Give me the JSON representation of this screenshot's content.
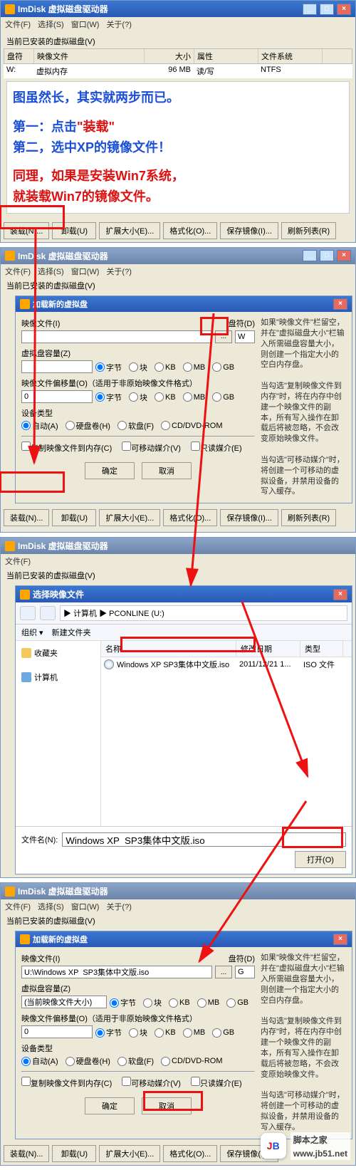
{
  "win1": {
    "title": "ImDisk 虚拟磁盘驱动器",
    "menu": [
      "文件(F)",
      "选择(S)",
      "窗口(W)",
      "关于(?)"
    ],
    "installed_label": "当前已安装的虚拟磁盘(V)",
    "cols": {
      "drive": "盘符",
      "image": "映像文件",
      "size": "大小",
      "attr": "属性",
      "fs": "文件系统"
    },
    "row": {
      "drive": "W:",
      "image": "虚拟内存",
      "size": "96 MB",
      "attr": "读/写",
      "fs": "NTFS"
    },
    "ann1": "图虽然长，其实就两步而已。",
    "ann2a": "第一：点击",
    "ann2b": "\"装载\"",
    "ann3": "第二，选中XP的镜像文件！",
    "ann4a": "同理，如果是安装Win7系统，",
    "ann4b": "就装载Win7的镜像文件。",
    "buttons": [
      "装载(N)...",
      "卸载(U)",
      "扩展大小(E)...",
      "格式化(O)...",
      "保存镜像(I)...",
      "刷新列表(R)"
    ]
  },
  "dlg": {
    "title": "加载新的虚拟盘",
    "image_label": "映像文件(I)",
    "drive_label": "盘符(D)",
    "drive_value_empty": "W",
    "drive_value_set": "G",
    "capacity_label": "虚拟盘容量(Z)",
    "capacity_hint": "(当前映像文件大小)",
    "units": [
      "字节",
      "块",
      "KB",
      "MB",
      "GB"
    ],
    "offset_label": "映像文件偏移量(O)（适用于非原始映像文件格式）",
    "offset_value": "0",
    "device_label": "设备类型",
    "devices": [
      "自动(A)",
      "硬盘卷(H)",
      "软盘(F)",
      "CD/DVD-ROM"
    ],
    "checks": [
      "复制映像文件到内存(C)",
      "可移动媒介(V)",
      "只读媒介(E)"
    ],
    "ok": "确定",
    "cancel": "取消",
    "help1": "如果\"映像文件\"栏留空，并在\"虚拟磁盘大小\"栏输入所需磁盘容量大小，则创建一个指定大小的空白内存盘。",
    "help2": "当勾选\"复制映像文件到内存\"时，将在内存中创建一个映像文件的副本，所有写入操作在卸载后将被忽略，不会改变原始映像文件。",
    "help3": "当勾选\"可移动媒介\"时，将创建一个可移动的虚拟设备，并禁用设备的写入缓存。",
    "image_path": "U:\\Windows XP  SP3集体中文版.iso"
  },
  "explorer": {
    "title": "选择映像文件",
    "address": "▶ 计算机 ▶ PCONLINE (U:)",
    "organize": "组织 ▾",
    "newfolder": "新建文件夹",
    "side_fav": "收藏夹",
    "side_comp": "计算机",
    "cols": {
      "name": "名称",
      "date": "修改日期",
      "type": "类型"
    },
    "file": {
      "name": "Windows XP SP3集体中文版.iso",
      "date": "2011/12/21 1...",
      "type": "ISO 文件"
    },
    "filename_label": "文件名(N):",
    "filename_value": "Windows XP  SP3集体中文版.iso",
    "open": "打开(O)"
  },
  "watermark": {
    "logo": "JB",
    "text1": "脚本之家",
    "text2": "www.jb51.net"
  }
}
